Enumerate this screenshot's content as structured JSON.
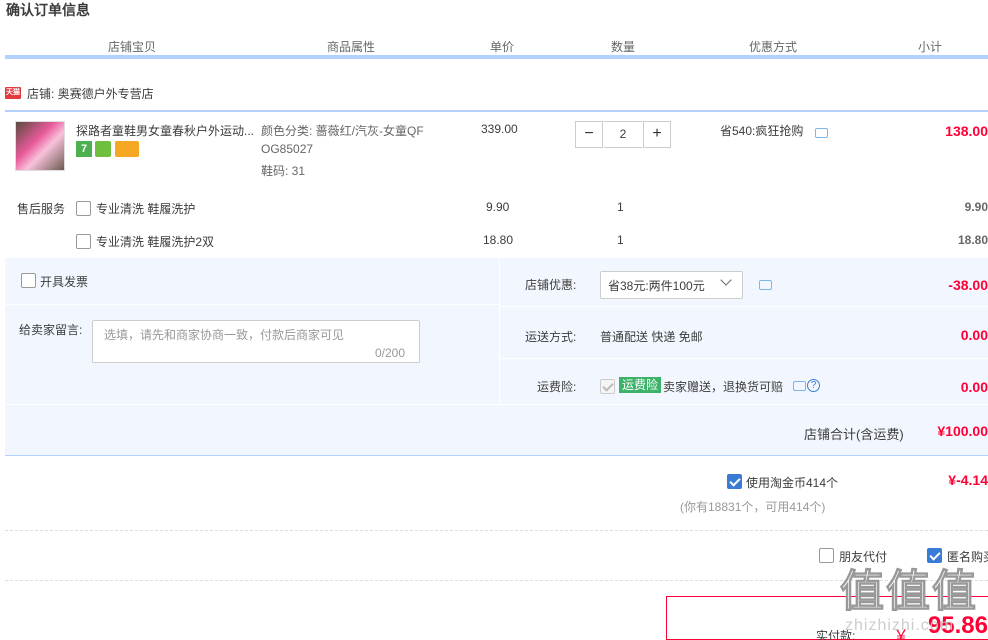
{
  "title": "确认订单信息",
  "columns": [
    "店铺宝贝",
    "商品属性",
    "单价",
    "数量",
    "优惠方式",
    "小计"
  ],
  "shop": {
    "badge": "天猫",
    "name": "店铺: 奥赛德户外专营店"
  },
  "product": {
    "title": "探路者童鞋男女童春秋户外运动...",
    "attr_color": "颜色分类: 蔷薇红/汽灰-女童QF",
    "attr_color2": "OG85027",
    "attr_size": "鞋码: 31",
    "price": "339.00",
    "qty": "2",
    "promo": "省540:疯狂抢购",
    "subtotal": "138.00",
    "badge_seven": "7"
  },
  "service": {
    "label": "售后服务",
    "items": [
      {
        "name": "专业清洗 鞋履洗护",
        "price": "9.90",
        "qty": "1",
        "subtotal": "9.90"
      },
      {
        "name": "专业清洗 鞋履洗护2双",
        "price": "18.80",
        "qty": "1",
        "subtotal": "18.80"
      }
    ]
  },
  "invoice_label": "开具发票",
  "message": {
    "label": "给卖家留言:",
    "placeholder": "选填，请先和商家协商一致，付款后商家可见",
    "count": "0/200"
  },
  "shop_discount": {
    "label": "店铺优惠:",
    "selected": "省38元:两件100元",
    "value": "-38.00"
  },
  "shipping": {
    "label": "运送方式:",
    "method": "普通配送 快递 免邮",
    "value": "0.00"
  },
  "insurance": {
    "label": "运费险:",
    "tag": "运费险",
    "desc": "卖家赠送，退换货可赔",
    "value": "0.00",
    "help": "?"
  },
  "shop_total": {
    "label": "店铺合计(含运费)",
    "value": "¥100.00"
  },
  "coins": {
    "label": "使用淘金币414个",
    "value": "¥-4.14",
    "note": "(你有18831个，可用414个)"
  },
  "friend_pay": "朋友代付",
  "anon_buy": "匿名购买",
  "pay": {
    "label": "实付款:",
    "yen": "￥",
    "value": "95.86"
  },
  "watermark": {
    "main": "值值值",
    "sub": "zhizhizhi.com"
  },
  "colors": {
    "accent_red": "#ff0036",
    "header_bar": "#b2d1ff",
    "panel_bg": "#f2f7ff",
    "checkbox_blue": "#3a7bd5",
    "tag_green": "#3db36a"
  }
}
